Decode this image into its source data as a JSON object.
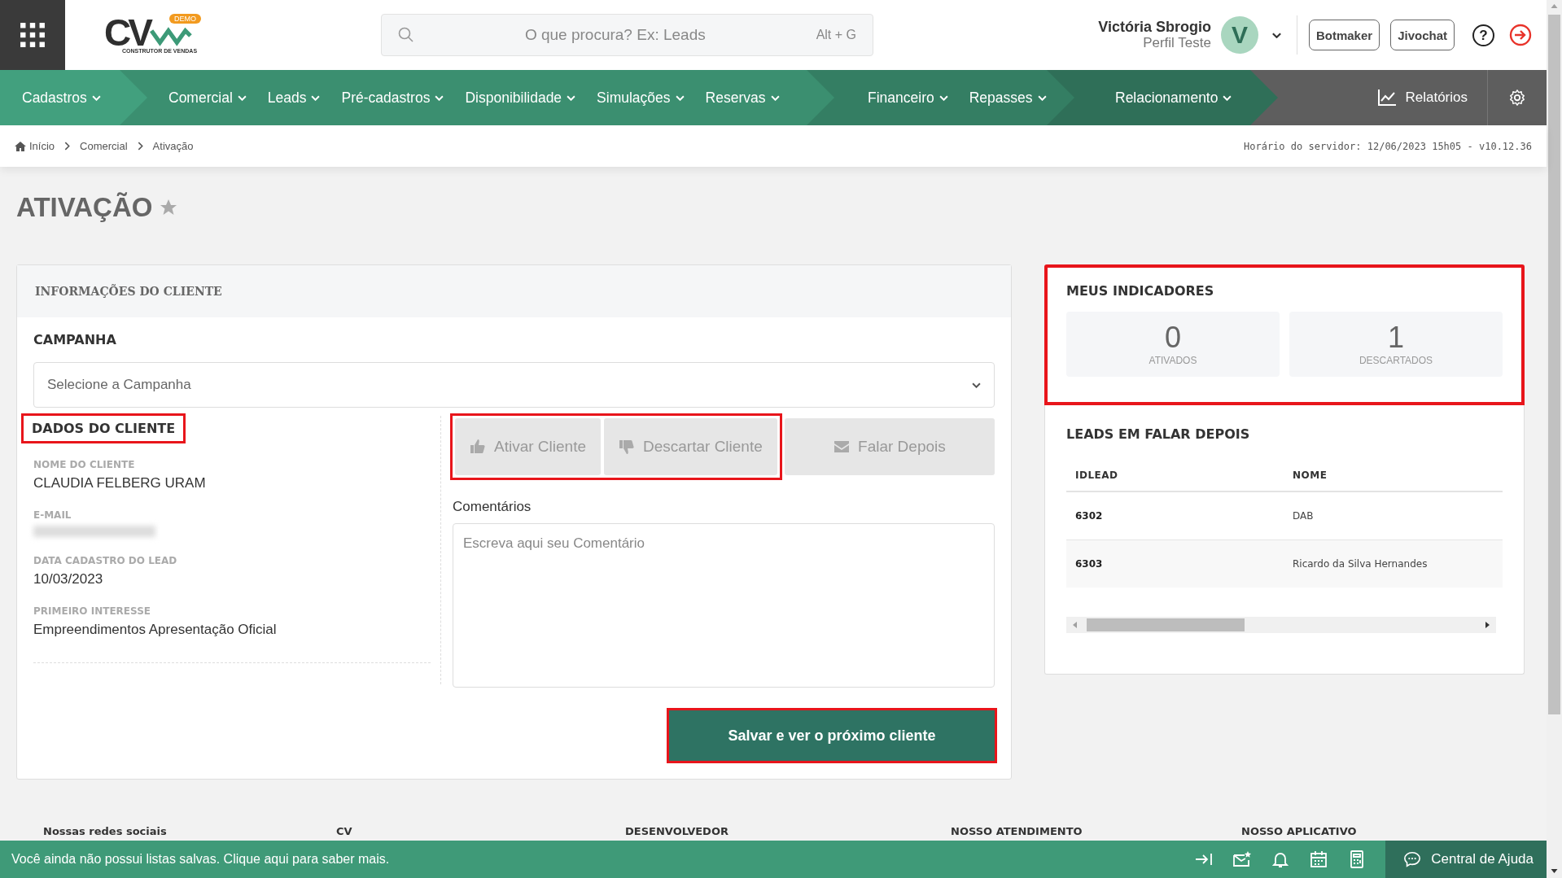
{
  "header": {
    "logo_text": "CV",
    "logo_badge": "DEMO",
    "logo_tagline": "CONSTRUTOR DE VENDAS",
    "search_placeholder": "O que procura? Ex: Leads",
    "search_shortcut": "Alt + G",
    "user": {
      "name": "Victória Sbrogio",
      "profile": "Perfil Teste",
      "initial": "V"
    },
    "buttons": [
      "Botmaker",
      "Jivochat"
    ],
    "help_icon": "?"
  },
  "nav": {
    "groups": [
      {
        "items": [
          "Cadastros"
        ]
      },
      {
        "items": [
          "Comercial",
          "Leads",
          "Pré-cadastros",
          "Disponibilidade",
          "Simulações",
          "Reservas"
        ]
      },
      {
        "items": [
          "Financeiro",
          "Repasses"
        ]
      },
      {
        "items": [
          "Relacionamento"
        ]
      }
    ],
    "reports": "Relatórios"
  },
  "breadcrumb": [
    "Início",
    "Comercial",
    "Ativação"
  ],
  "server_time": "Horário do servidor: 12/06/2023 15h05 - v10.12.36",
  "page_title": "ATIVAÇÃO",
  "favorite": false,
  "client": {
    "header": "INFORMAÇÕES DO CLIENTE",
    "campaign_label": "CAMPANHA",
    "campaign_placeholder": "Selecione a Campanha",
    "data_title": "DADOS DO CLIENTE",
    "data_title_highlighted": true,
    "fields": [
      {
        "label": "NOME DO CLIENTE",
        "value": "CLAUDIA FELBERG URAM",
        "blurred": false
      },
      {
        "label": "E-MAIL",
        "blurred": true
      },
      {
        "label": "DATA CADASTRO DO LEAD",
        "value": "10/03/2023",
        "blurred": false
      },
      {
        "label": "PRIMEIRO INTERESSE",
        "value": "Empreendimentos Apresentação Oficial",
        "blurred": false
      }
    ],
    "actions": [
      {
        "kind": "thumbs-up",
        "label": "Ativar Cliente",
        "highlighted": true
      },
      {
        "kind": "thumbs-down",
        "label": "Descartar Cliente",
        "highlighted": true
      },
      {
        "kind": "envelope",
        "label": "Falar Depois",
        "highlighted": false
      }
    ],
    "comments_label": "Comentários",
    "comments_placeholder": "Escreva aqui seu Comentário",
    "save_button": {
      "label": "Salvar e ver o próximo cliente",
      "highlighted": true
    }
  },
  "indicators": {
    "title": "MEUS INDICADORES",
    "highlighted": true,
    "items": [
      {
        "value": "0",
        "label": "ATIVADOS"
      },
      {
        "value": "1",
        "label": "DESCARTADOS"
      }
    ]
  },
  "leads_later": {
    "title": "LEADS EM FALAR DEPOIS",
    "columns": [
      "IDLEAD",
      "NOME"
    ],
    "rows": [
      [
        "6302",
        "DAB"
      ],
      [
        "6303",
        "Ricardo da Silva Hernandes"
      ]
    ]
  },
  "footer_headings": [
    "Nossas redes sociais",
    "CV",
    "DESENVOLVEDOR",
    "NOSSO ATENDIMENTO",
    "NOSSO APLICATIVO"
  ],
  "bottom_bar": {
    "message": "Você ainda não possui listas salvas. Clique aqui para saber mais.",
    "help": "Central de Ajuda"
  }
}
